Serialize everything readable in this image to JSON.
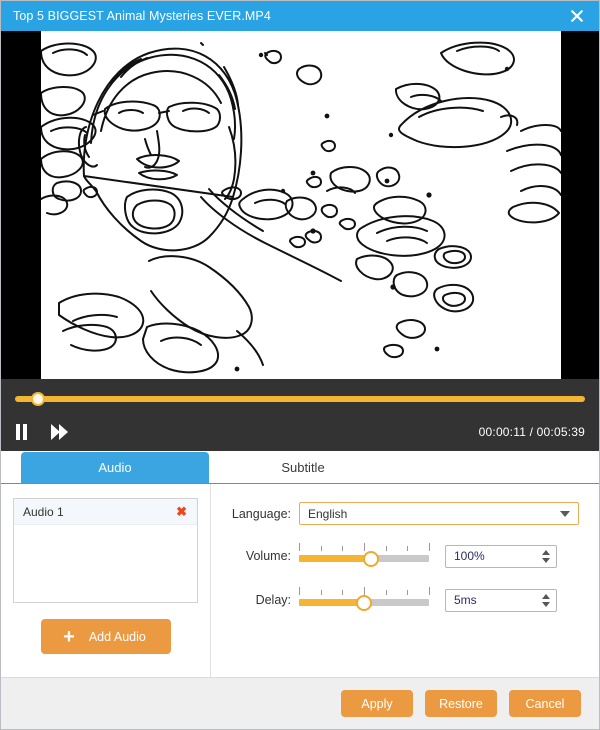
{
  "window": {
    "title": "Top 5 BIGGEST Animal Mysteries EVER.MP4",
    "close_label": "×"
  },
  "player": {
    "current_time": "00:00:11",
    "total_time": "00:05:39",
    "time_display": "00:00:11 / 00:05:39",
    "progress_percent": 4,
    "pause_icon": "pause-icon",
    "forward_icon": "fast-forward-icon",
    "accent_color": "#f2b632",
    "background_color": "#333333"
  },
  "tabs": [
    {
      "label": "Audio",
      "active": true
    },
    {
      "label": "Subtitle",
      "active": false
    }
  ],
  "audio_panel": {
    "items": [
      {
        "label": "Audio 1",
        "remove_label": "✖"
      }
    ],
    "add_button": {
      "label": "Add Audio",
      "icon": "plus-icon",
      "plus_glyph": "+"
    }
  },
  "settings": {
    "language": {
      "label": "Language:",
      "value": "English",
      "arrow_icon": "chevron-down-icon"
    },
    "volume": {
      "label": "Volume:",
      "value": "100%",
      "slider_percent": 55,
      "tick_count": 7
    },
    "delay": {
      "label": "Delay:",
      "value": "5ms",
      "slider_percent": 50,
      "tick_count": 7
    }
  },
  "footer": {
    "buttons": [
      {
        "label": "Apply"
      },
      {
        "label": "Restore"
      },
      {
        "label": "Cancel"
      }
    ]
  },
  "colors": {
    "titlebar": "#29a3e3",
    "accent_orange": "#eb9a42",
    "slider_orange": "#f5b433",
    "tab_active": "#3aa5e0",
    "remove_red": "#e8481c"
  }
}
